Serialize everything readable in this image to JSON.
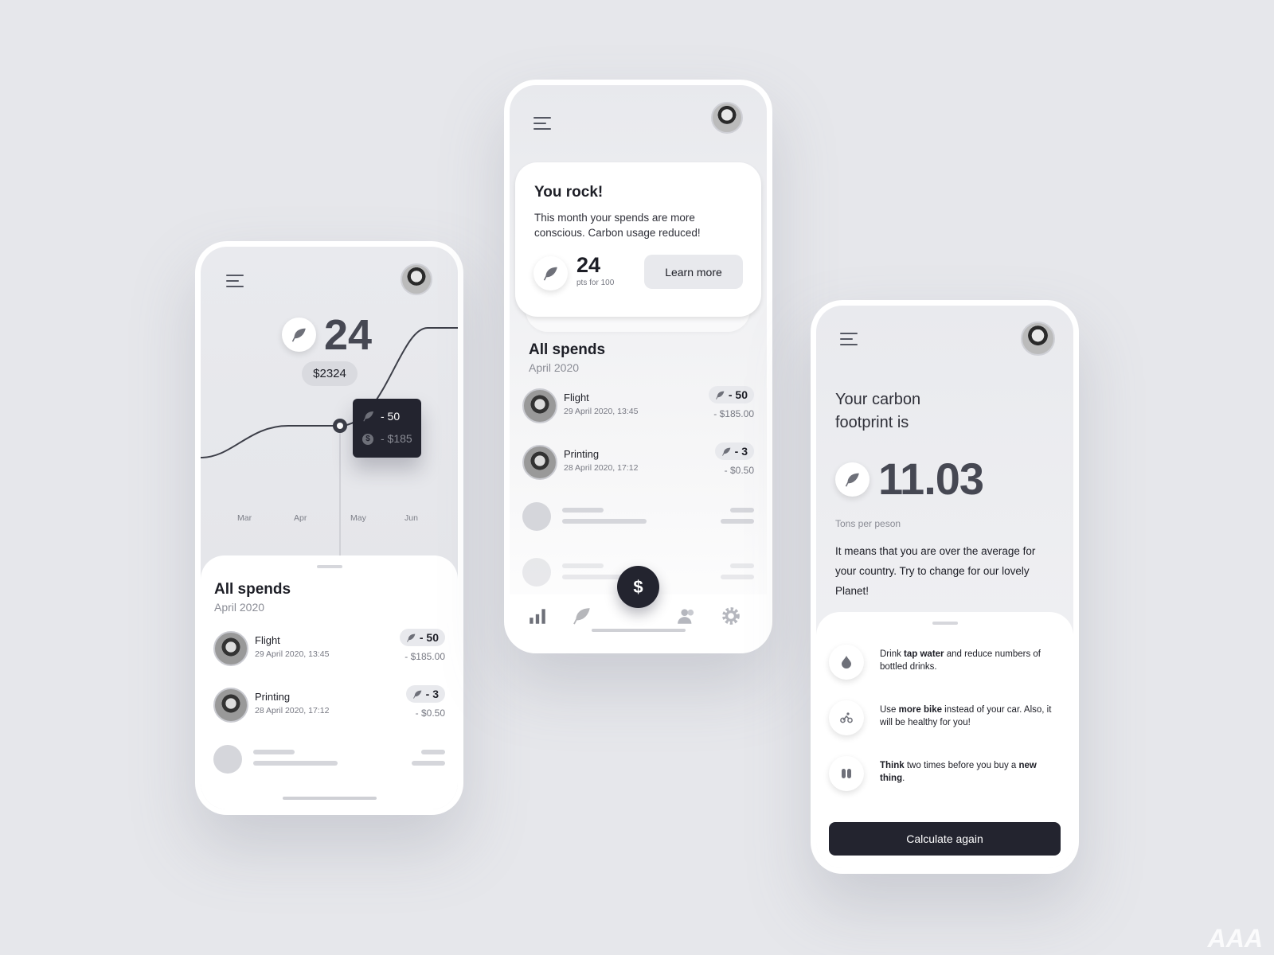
{
  "colors": {
    "background": "#e6e7eb",
    "dark": "#23242f",
    "accent_grey": "#e8e9ed"
  },
  "icons": {
    "leaf": "leaf-icon",
    "dollar": "dollar-icon",
    "menu": "menu-icon",
    "water": "water-drop-icon",
    "bike": "bike-icon",
    "think": "footprints-icon",
    "chart": "bar-chart-icon",
    "people": "people-icon",
    "settings": "gear-icon"
  },
  "screen1": {
    "points": "24",
    "balance": "$2324",
    "chart": {
      "months": [
        "Mar",
        "Apr",
        "May",
        "Jun"
      ],
      "selected": "May",
      "tooltip": {
        "points": "- 50",
        "amount": "- $185"
      }
    },
    "spends": {
      "title": "All spends",
      "period": "April 2020",
      "items": [
        {
          "title": "Flight",
          "date": "29 April 2020, 13:45",
          "points": "- 50",
          "amount": "- $185.00"
        },
        {
          "title": "Printing",
          "date": "28 April 2020, 17:12",
          "points": "- 3",
          "amount": "- $0.50"
        }
      ]
    }
  },
  "screen2": {
    "card": {
      "title": "You rock!",
      "text": "This month your spends are more conscious. Carbon usage reduced!",
      "points": "24",
      "points_caption": "pts for 100",
      "button": "Learn more"
    },
    "spends": {
      "title": "All spends",
      "period": "April 2020",
      "items": [
        {
          "title": "Flight",
          "date": "29 April 2020, 13:45",
          "points": "- 50",
          "amount": "- $185.00"
        },
        {
          "title": "Printing",
          "date": "28 April 2020, 17:12",
          "points": "- 3",
          "amount": "- $0.50"
        }
      ]
    },
    "fab": "$"
  },
  "screen3": {
    "title": "Your carbon footprint is",
    "value": "11.03",
    "unit": "Tons per peson",
    "text": "It means that you are over the average for your country. Try to change for our lovely Planet!",
    "tips": [
      {
        "pre": "Drink ",
        "bold": "tap water",
        "post": " and reduce numbers of bottled drinks.",
        "bold2": "",
        "post2": ""
      },
      {
        "pre": "Use ",
        "bold": "more bike",
        "post": " instead of your car. Also, it will be healthy for you!",
        "bold2": "",
        "post2": ""
      },
      {
        "pre": "",
        "bold": "Think",
        "post": " two times before you buy a ",
        "bold2": "new thing",
        "post2": "."
      }
    ],
    "button": "Calculate again"
  },
  "watermark": "AAA"
}
